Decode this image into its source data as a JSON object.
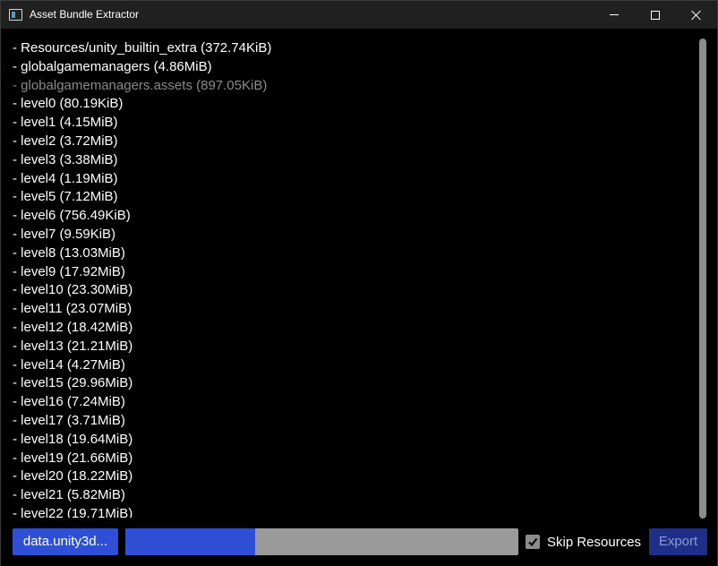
{
  "window": {
    "title": "Asset Bundle Extractor"
  },
  "list": {
    "items": [
      {
        "text": "- Resources/unity_builtin_extra (372.74KiB)",
        "dim": false
      },
      {
        "text": "- globalgamemanagers (4.86MiB)",
        "dim": false
      },
      {
        "text": "- globalgamemanagers.assets (897.05KiB)",
        "dim": true
      },
      {
        "text": "- level0 (80.19KiB)",
        "dim": false
      },
      {
        "text": "- level1 (4.15MiB)",
        "dim": false
      },
      {
        "text": "- level2 (3.72MiB)",
        "dim": false
      },
      {
        "text": "- level3 (3.38MiB)",
        "dim": false
      },
      {
        "text": "- level4 (1.19MiB)",
        "dim": false
      },
      {
        "text": "- level5 (7.12MiB)",
        "dim": false
      },
      {
        "text": "- level6 (756.49KiB)",
        "dim": false
      },
      {
        "text": "- level7 (9.59KiB)",
        "dim": false
      },
      {
        "text": "- level8 (13.03MiB)",
        "dim": false
      },
      {
        "text": "- level9 (17.92MiB)",
        "dim": false
      },
      {
        "text": "- level10 (23.30MiB)",
        "dim": false
      },
      {
        "text": "- level11 (23.07MiB)",
        "dim": false
      },
      {
        "text": "- level12 (18.42MiB)",
        "dim": false
      },
      {
        "text": "- level13 (21.21MiB)",
        "dim": false
      },
      {
        "text": "- level14 (4.27MiB)",
        "dim": false
      },
      {
        "text": "- level15 (29.96MiB)",
        "dim": false
      },
      {
        "text": "- level16 (7.24MiB)",
        "dim": false
      },
      {
        "text": "- level17 (3.71MiB)",
        "dim": false
      },
      {
        "text": "- level18 (19.64MiB)",
        "dim": false
      },
      {
        "text": "- level19 (21.66MiB)",
        "dim": false
      },
      {
        "text": "- level20 (18.22MiB)",
        "dim": false
      },
      {
        "text": "- level21 (5.82MiB)",
        "dim": false
      },
      {
        "text": "- level22 (19.71MiB)",
        "dim": false
      }
    ]
  },
  "bottom": {
    "file_button": "data.unity3d...",
    "progress": 0.33,
    "skip_resources_label": "Skip Resources",
    "skip_resources_checked": true,
    "export_label": "Export"
  },
  "colors": {
    "accent": "#2f4fd6",
    "export_disabled": "#1e2f8a",
    "dim_text": "#8a8a8a"
  },
  "icons": {
    "app": "app-window-icon",
    "minimize": "minimize-icon",
    "maximize": "maximize-icon",
    "close": "close-icon",
    "checkbox": "checkmark-icon"
  }
}
